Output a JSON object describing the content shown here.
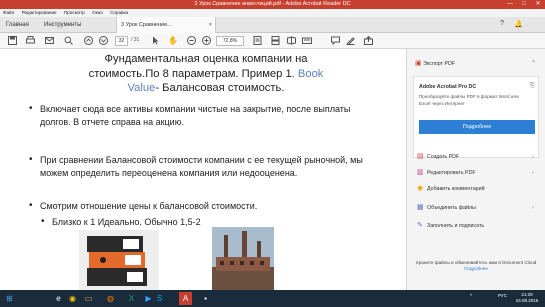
{
  "window": {
    "title": "3 Урок Сравнение инвестиций.pdf - Adobe Acrobat Reader DC",
    "min": "—",
    "max": "□",
    "close": "✕"
  },
  "menu": [
    "Файл",
    "Редактирование",
    "Просмотр",
    "Окно",
    "Справка"
  ],
  "tabs": {
    "home": "Главная",
    "tools": "Инструменты",
    "doc": "3 Урок  Сравнение...",
    "close": "×"
  },
  "toolbar": {
    "page_current": "32",
    "page_total": "/ 31",
    "zoom": "72,8%"
  },
  "slide": {
    "title_l1": "Фундаментальная оценка компании на",
    "title_l2": "стоимость.По 8 параметрам. Пример 1. ",
    "title_hl1": "Book",
    "title_hl2": "Value",
    "title_l3": "- Балансовая стоимость.",
    "b1": "Включает сюда все активы компании чистые на закрытие, после выплаты долгов. В отчете справа на акцию.",
    "b2": "При сравнении Балансовой стоимости компании с ее текущей рыночной, мы можем определить переоценена компания или недооценена.",
    "b3": "Смотрим отношение цены к балансовой стоимости.",
    "b4": "Близко к 1 Идеально. Обычно 1,5-2"
  },
  "sidebar": {
    "export_pdf": "Экспорт PDF",
    "card_title": "Adobe Acrobat Pro DC",
    "card_desc": "Преобразуйте файлы PDF в формат Word или Excel через Интернет",
    "card_button": "Подробнее",
    "items": [
      "Создать PDF",
      "Редактировать PDF",
      "Добавить комментарий",
      "Объединить файлы",
      "Заполнить и подписать"
    ],
    "footer": "Храните файлы и обменивайтесь ими в Document Cloud",
    "footer_link": "Подробнее"
  },
  "taskbar": {
    "lang": "РУС",
    "time": "21:29",
    "date": "24.08.2016"
  }
}
